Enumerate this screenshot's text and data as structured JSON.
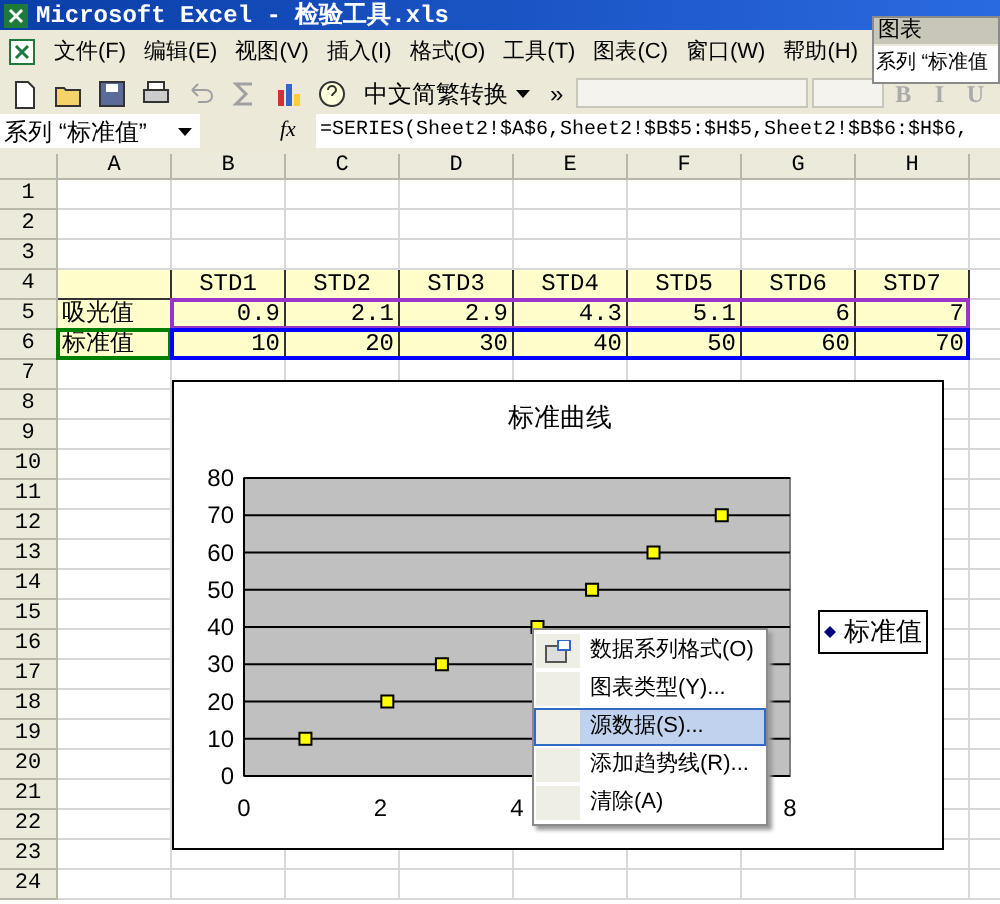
{
  "window": {
    "title": "Microsoft Excel - 检验工具.xls"
  },
  "menu_bar": [
    "文件(F)",
    "编辑(E)",
    "视图(V)",
    "插入(I)",
    "格式(O)",
    "工具(T)",
    "图表(C)",
    "窗口(W)",
    "帮助(H)"
  ],
  "toolbar": {
    "items": [
      {
        "kind": "new",
        "disabled": false
      },
      {
        "kind": "open",
        "disabled": false
      },
      {
        "kind": "save",
        "disabled": false
      },
      {
        "kind": "print",
        "disabled": false
      },
      {
        "kind": "undo",
        "disabled": true
      },
      {
        "kind": "sum",
        "disabled": true
      },
      {
        "kind": "chart",
        "disabled": false
      },
      {
        "kind": "help",
        "disabled": false
      }
    ],
    "convert_button": "中文简繁转换",
    "more": "»",
    "format_buttons": [
      {
        "label": "B",
        "disabled": true
      },
      {
        "label": "I",
        "disabled": true
      },
      {
        "label": "U",
        "disabled": true
      }
    ]
  },
  "chart_toolbar": {
    "title": "图表",
    "selector": "系列 “标准值"
  },
  "formula_bar": {
    "name_box": "系列 “标准值”",
    "function_label": "fx",
    "formula": "=SERIES(Sheet2!$A$6,Sheet2!$B$5:$H$5,Sheet2!$B$6:$H$6,"
  },
  "sheet": {
    "columns": [
      "A",
      "B",
      "C",
      "D",
      "E",
      "F",
      "G",
      "H"
    ],
    "rows": [
      {
        "number": "1",
        "filled": false
      },
      {
        "number": "2",
        "filled": false
      },
      {
        "number": "3",
        "filled": false
      },
      {
        "number": "4",
        "filled": true,
        "values": [
          "STD1",
          "STD2",
          "STD3",
          "STD4",
          "STD5",
          "STD6",
          "STD7"
        ]
      },
      {
        "number": "5",
        "filled": true,
        "label": "吸光值",
        "values": [
          "0.9",
          "2.1",
          "2.9",
          "4.3",
          "5.1",
          "6",
          "7"
        ],
        "values_range": {
          "color": "#9933cc"
        }
      },
      {
        "number": "6",
        "filled": true,
        "label": "标准值",
        "label_range": {
          "color": "#008000"
        },
        "values": [
          "10",
          "20",
          "30",
          "40",
          "50",
          "60",
          "70"
        ],
        "values_range": {
          "color": "#0000ff"
        }
      },
      {
        "number": "7",
        "filled": false
      },
      {
        "number": "8",
        "filled": false
      },
      {
        "number": "9",
        "filled": false
      },
      {
        "number": "10",
        "filled": false
      },
      {
        "number": "11",
        "filled": false
      },
      {
        "number": "12",
        "filled": false
      },
      {
        "number": "13",
        "filled": false
      },
      {
        "number": "14",
        "filled": false
      },
      {
        "number": "15",
        "filled": false
      },
      {
        "number": "16",
        "filled": false
      },
      {
        "number": "17",
        "filled": false
      },
      {
        "number": "18",
        "filled": false
      },
      {
        "number": "19",
        "filled": false
      },
      {
        "number": "20",
        "filled": false
      },
      {
        "number": "21",
        "filled": false
      },
      {
        "number": "22",
        "filled": false
      },
      {
        "number": "23",
        "filled": false
      },
      {
        "number": "24",
        "filled": false
      }
    ]
  },
  "chart": {
    "chart_data": {
      "type": "scatter",
      "title": "标准曲线",
      "grid": true,
      "x": [
        0.9,
        2.1,
        2.9,
        4.3,
        5.1,
        6,
        7
      ],
      "xlim": [
        0,
        8
      ],
      "ylim": [
        0,
        80
      ],
      "xticks": [
        {
          "value": 0,
          "label": "0"
        },
        {
          "value": 2,
          "label": "2"
        },
        {
          "value": 4,
          "label": "4"
        },
        {
          "value": 8,
          "label": "8"
        }
      ],
      "yticks": [
        {
          "value": 0,
          "label": "0"
        },
        {
          "value": 10,
          "label": "10"
        },
        {
          "value": 20,
          "label": "20"
        },
        {
          "value": 30,
          "label": "30"
        },
        {
          "value": 40,
          "label": "40"
        },
        {
          "value": 50,
          "label": "50"
        },
        {
          "value": 60,
          "label": "60"
        },
        {
          "value": 70,
          "label": "70"
        },
        {
          "value": 80,
          "label": "80"
        }
      ],
      "series": [
        {
          "name": "标准值",
          "color": "#ffff00",
          "values": [
            10,
            20,
            30,
            40,
            50,
            60,
            70
          ]
        }
      ]
    }
  },
  "context_menu": [
    {
      "label": "数据系列格式(O)",
      "selected": false,
      "kind": "icon"
    },
    {
      "label": "图表类型(Y)...",
      "selected": false,
      "kind": "plain"
    },
    {
      "label": "源数据(S)...",
      "selected": true,
      "kind": "plain"
    },
    {
      "label": "添加趋势线(R)...",
      "selected": false,
      "kind": "plain"
    },
    {
      "label": "清除(A)",
      "selected": false,
      "kind": "plain"
    }
  ]
}
